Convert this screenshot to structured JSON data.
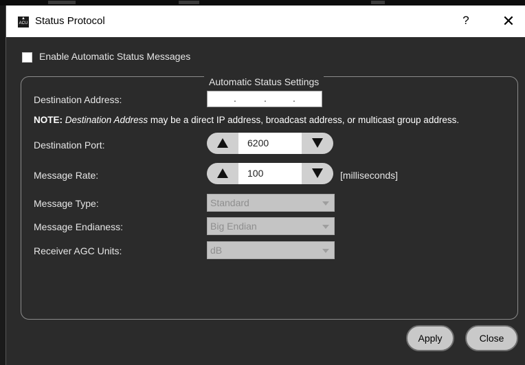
{
  "window": {
    "title": "Status Protocol",
    "icon_text": "ACU",
    "help_label": "?",
    "close_label": "✕"
  },
  "enable": {
    "label": "Enable Automatic Status Messages",
    "checked": false
  },
  "group": {
    "title": "Automatic Status Settings"
  },
  "fields": {
    "destination_address_label": "Destination Address:",
    "ip_separator": ".",
    "note_bold": "NOTE:",
    "note_italic": "Destination Address",
    "note_rest": "may be a direct IP address, broadcast address, or multicast group address.",
    "destination_port_label": "Destination Port:",
    "destination_port_value": "6200",
    "message_rate_label": "Message Rate:",
    "message_rate_value": "100",
    "message_rate_unit": "[milliseconds]",
    "message_type_label": "Message Type:",
    "message_type_value": "Standard",
    "message_endianess_label": "Message Endianess:",
    "message_endianess_value": "Big Endian",
    "receiver_agc_label": "Receiver AGC Units:",
    "receiver_agc_value": "dB"
  },
  "buttons": {
    "apply": "Apply",
    "close": "Close"
  },
  "icons": [
    "app-icon",
    "help-icon",
    "close-icon",
    "arrow-up-icon",
    "arrow-down-icon",
    "dropdown-caret-icon"
  ]
}
